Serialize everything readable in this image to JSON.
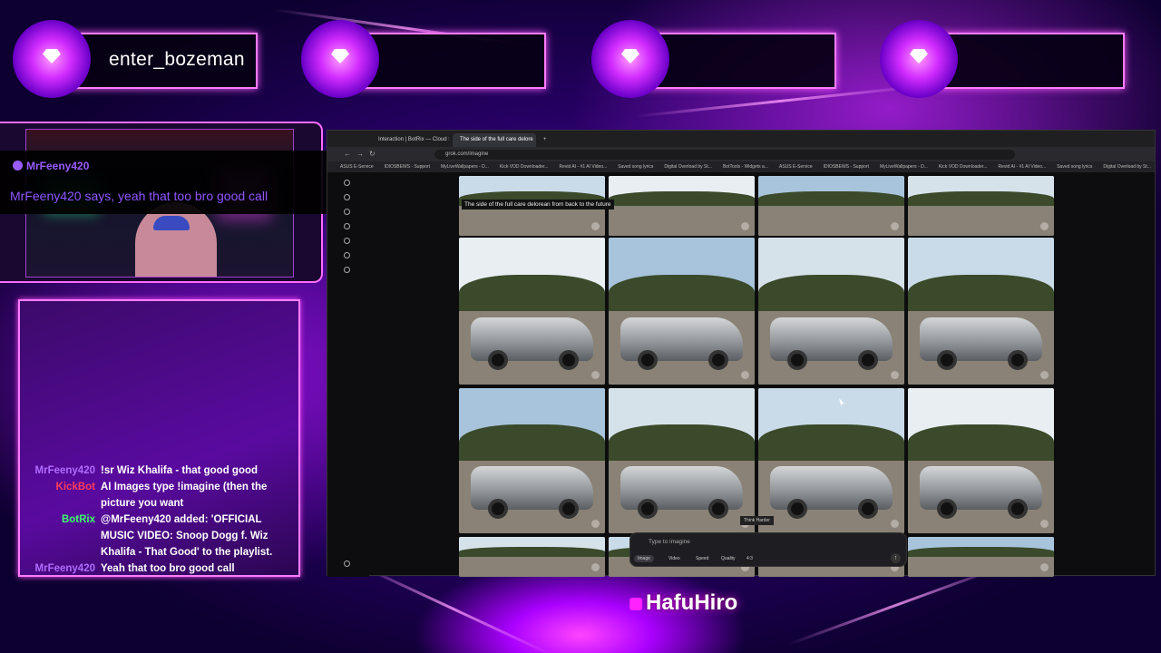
{
  "top_badges": [
    {
      "name": "enter_bozeman"
    },
    {
      "name": ""
    },
    {
      "name": ""
    },
    {
      "name": ""
    }
  ],
  "alert": {
    "username": "MrFeeny420",
    "message": "MrFeeny420 says, yeah that too bro good call"
  },
  "chat": [
    {
      "user": "MrFeeny420",
      "color": "#b06cff",
      "text": "!sr Wiz Khalifa - that good good"
    },
    {
      "user": "KickBot",
      "color": "#ff3c5c",
      "text": "AI Images type !imagine (then the picture you want"
    },
    {
      "user": "BotRix",
      "color": "#3cff6c",
      "text": "@MrFeeny420 added: 'OFFICIAL MUSIC VIDEO: Snoop Dogg f. Wiz Khalifa - That Good' to the playlist."
    },
    {
      "user": "MrFeeny420",
      "color": "#b06cff",
      "text": "Yeah that too bro good call"
    }
  ],
  "browser": {
    "tabs": [
      "Interaction | BotRix — Cloud St",
      "The side of the full care delore"
    ],
    "url": "grok.com/imagine",
    "bookmarks": [
      "ASUS E-Service",
      "IDIOSBEWS - Support",
      "MyLiveWallpapers - D...",
      "Kick VOD Downloader...",
      "Revid AI - #1 AI Video...",
      "Saved song lyrics",
      "Digital Overload by St...",
      "BotTools - Widgets a...",
      "ASUS E-Service",
      "IDIOSBEWS - Support",
      "MyLiveWallpapers - D...",
      "Kick VOD Downloader...",
      "Revid AI - #1 AI Video...",
      "Saved song lyrics",
      "Digital Overload by St..."
    ],
    "caption": "The side of the full care delorean from back to the future",
    "tooltip": "Think Harder",
    "compose": {
      "placeholder": "Type to imagine",
      "chips": [
        "Image",
        "Video",
        "Speed",
        "Quality",
        "4:3"
      ]
    }
  },
  "brand": {
    "name": "HafuHiro"
  }
}
